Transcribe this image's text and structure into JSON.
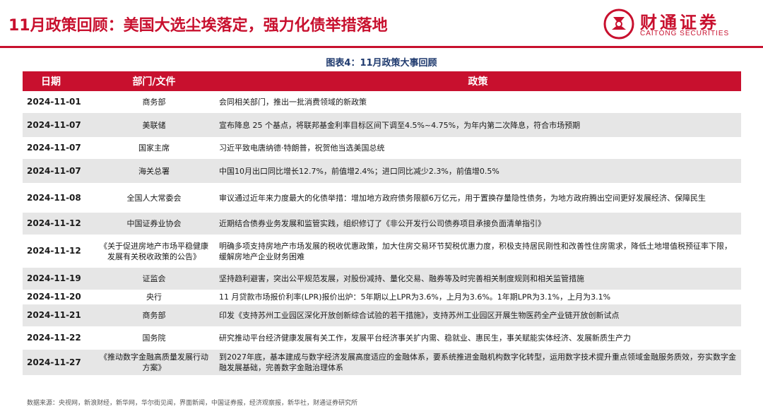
{
  "header": {
    "title": "11月政策回顾：美国大选尘埃落定，强力化债举措落地",
    "logo_cn": "财通证券",
    "logo_en": "CAITONG SECURITIES",
    "accent_color": "#c8102e"
  },
  "figure": {
    "caption": "图表4：11月政策大事回顾"
  },
  "table": {
    "columns": [
      "日期",
      "部门/文件",
      "政策"
    ],
    "rows": [
      {
        "date": "2024-11-01",
        "dept": "商务部",
        "policy": "会同相关部门，推出一批消费领域的新政策"
      },
      {
        "date": "2024-11-07",
        "dept": "美联储",
        "policy": "宣布降息 25 个基点，将联邦基金利率目标区间下调至4.5%~4.75%，为年内第二次降息，符合市场预期"
      },
      {
        "date": "2024-11-07",
        "dept": "国家主席",
        "policy": "习近平致电唐纳德·特朗普，祝贺他当选美国总统"
      },
      {
        "date": "2024-11-07",
        "dept": "海关总署",
        "policy": "中国10月出口同比增长12.7%，前值增2.4%；进口同比减少2.3%，前值增0.5%"
      },
      {
        "date": "2024-11-08",
        "dept": "全国人大常委会",
        "policy": "审议通过近年来力度最大的化债举措：增加地方政府债务限额6万亿元，用于置换存量隐性债务，为地方政府腾出空间更好发展经济、保障民生"
      },
      {
        "date": "2024-11-12",
        "dept": "中国证券业协会",
        "policy": "近期结合债券业务发展和监管实践，组织修订了《非公开发行公司债券项目承接负面清单指引》"
      },
      {
        "date": "2024-11-12",
        "dept": "《关于促进房地产市场平稳健康发展有关税收政策的公告》",
        "policy": "明确多项支持房地产市场发展的税收优惠政策，加大住房交易环节契税优惠力度，积极支持居民刚性和改善性住房需求，降低土地增值税预征率下限，缓解房地产企业财务困难"
      },
      {
        "date": "2024-11-19",
        "dept": "证监会",
        "policy": "坚持趋利避害，突出公平规范发展，对股份减持、量化交易、融券等及时完善相关制度规则和相关监管措施"
      },
      {
        "date": "2024-11-20",
        "dept": "央行",
        "policy": "11 月贷款市场报价利率(LPR)报价出炉：5年期以上LPR为3.6%，上月为3.6%。1年期LPR为3.1%，上月为3.1%"
      },
      {
        "date": "2024-11-21",
        "dept": "商务部",
        "policy": "印发《支持苏州工业园区深化开放创新综合试验的若干措施》，支持苏州工业园区开展生物医药全产业链开放创新试点"
      },
      {
        "date": "2024-11-22",
        "dept": "国务院",
        "policy": "研究推动平台经济健康发展有关工作，发展平台经济事关扩内需、稳就业、惠民生，事关赋能实体经济、发展新质生产力"
      },
      {
        "date": "2024-11-27",
        "dept": "《推动数字金融高质量发展行动方案》",
        "policy": "到2027年底，基本建成与数字经济发展高度适应的金融体系，要系统推进金融机构数字化转型，运用数字技术提升重点领域金融服务质效，夯实数字金融发展基础，完善数字金融治理体系"
      }
    ]
  },
  "footer": {
    "source": "数据来源：央视网，新浪财经，新华网，华尔街见闻，界面新闻，中国证券报，经济观察报，新华社，财通证券研究所"
  }
}
